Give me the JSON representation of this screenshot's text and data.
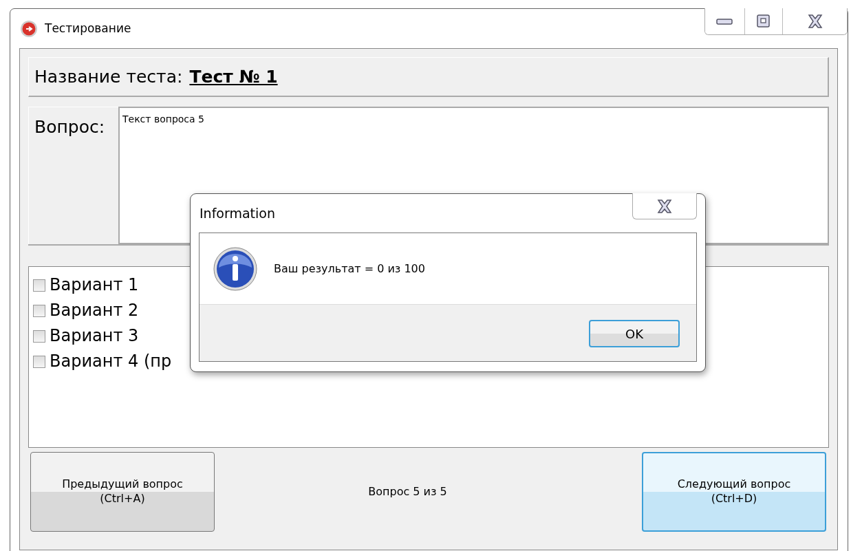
{
  "window": {
    "title": "Тестирование"
  },
  "test_name": {
    "label": "Название теста:",
    "value": "Тест № 1"
  },
  "question": {
    "label": "Вопрос:",
    "text": "Текст вопроса 5"
  },
  "options": [
    {
      "label": "Вариант 1",
      "checked": false
    },
    {
      "label": "Вариант 2",
      "checked": false
    },
    {
      "label": "Вариант 3",
      "checked": false
    },
    {
      "label": "Вариант 4 (пр",
      "checked": false
    }
  ],
  "buttons": [
    {
      "label": "Предыдущий вопрос",
      "shortcut": "(Ctrl+A)",
      "hovered": false
    },
    {
      "label": "Следующий вопрос",
      "shortcut": "(Ctrl+D)",
      "hovered": true
    }
  ],
  "progress": "Вопрос 5 из 5",
  "dialog": {
    "title": "Information",
    "message": "Ваш результат = 0 из 100",
    "button": "OK"
  }
}
